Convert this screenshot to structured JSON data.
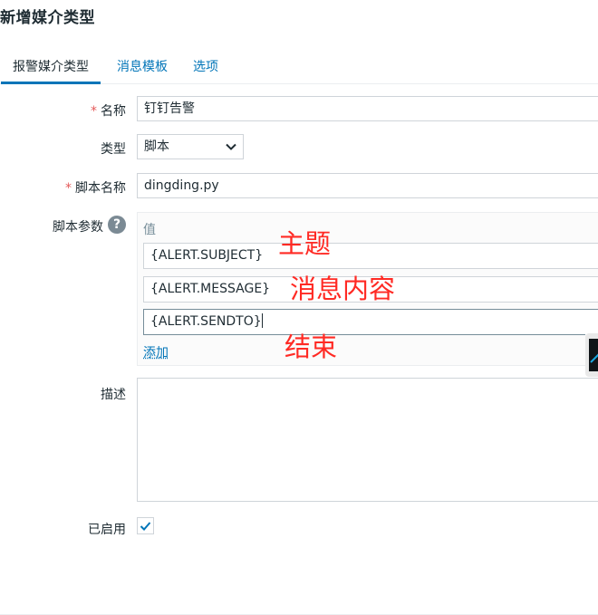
{
  "page": {
    "title": "新增媒介类型"
  },
  "tabs": [
    {
      "label": "报警媒介类型",
      "active": true
    },
    {
      "label": "消息模板",
      "active": false
    },
    {
      "label": "选项",
      "active": false
    }
  ],
  "form": {
    "required_mark": "*",
    "name": {
      "label": "名称",
      "value": "钉钉告警"
    },
    "type": {
      "label": "类型",
      "value": "脚本"
    },
    "script_name": {
      "label": "脚本名称",
      "value": "dingding.py"
    },
    "script_params": {
      "label": "脚本参数",
      "help_icon": "?",
      "column_header": "值",
      "values": [
        "{ALERT.SUBJECT}",
        "{ALERT.MESSAGE}",
        "{ALERT.SENDTO}"
      ],
      "add_label": "添加"
    },
    "description": {
      "label": "描述",
      "value": ""
    },
    "enabled": {
      "label": "已启用",
      "checked": true
    }
  },
  "annotations": [
    "主题",
    "消息内容",
    "结束"
  ],
  "colors": {
    "link": "#0275b8",
    "annotation": "#ff2a24",
    "required": "#e45959"
  }
}
